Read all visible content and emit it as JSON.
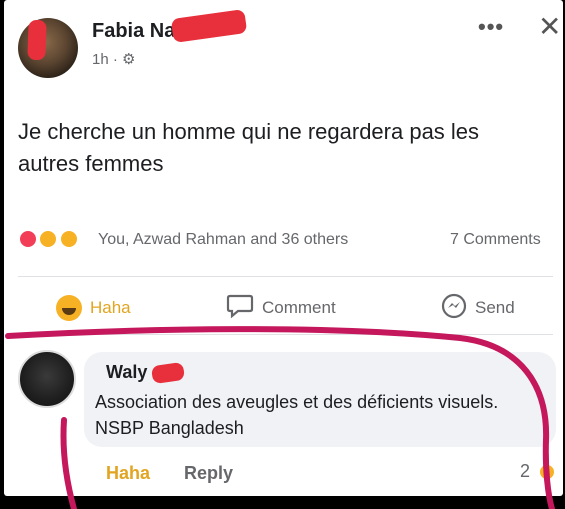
{
  "post": {
    "author": "Fabia Na",
    "time": "1h",
    "privacy_icon": "gear-icon",
    "text": "Je cherche un homme qui ne regardera pas les autres femmes",
    "reactions_summary": "You, Azwad Rahman and 36 others",
    "comments_count": "7 Comments"
  },
  "actions": {
    "haha": "Haha",
    "comment": "Comment",
    "send": "Send"
  },
  "comment": {
    "author": "Waly",
    "text": "Association des aveugles et des déficients visuels. NSBP Bangladesh",
    "haha": "Haha",
    "reply": "Reply",
    "reaction_count": "2"
  },
  "colors": {
    "haha_accent": "#e1a521",
    "marker": "#c4175c",
    "redaction": "#e8303c"
  }
}
